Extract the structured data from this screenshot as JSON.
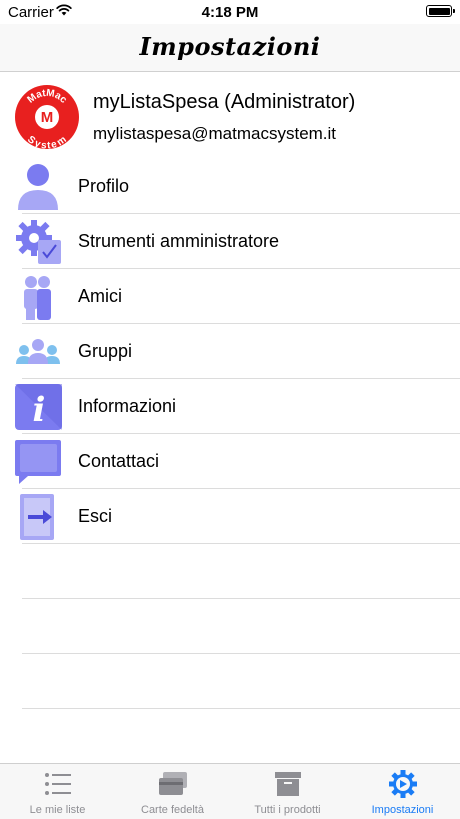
{
  "status": {
    "carrier": "Carrier",
    "time": "4:18 PM"
  },
  "header": {
    "title": "Impostazioni"
  },
  "user": {
    "name": "myListaSpesa (Administrator)",
    "email": "mylistaspesa@matmacsystem.it",
    "logo_text_top": "MatMac",
    "logo_letter": "M",
    "logo_text_bottom": "System"
  },
  "menu": {
    "items": [
      {
        "label": "Profilo",
        "icon": "person-icon"
      },
      {
        "label": "Strumenti amministratore",
        "icon": "admin-tools-icon"
      },
      {
        "label": "Amici",
        "icon": "friends-icon"
      },
      {
        "label": "Gruppi",
        "icon": "groups-icon"
      },
      {
        "label": "Informazioni",
        "icon": "info-icon"
      },
      {
        "label": "Contattaci",
        "icon": "chat-bubble-icon"
      },
      {
        "label": "Esci",
        "icon": "logout-icon"
      }
    ]
  },
  "tabs": [
    {
      "label": "Le mie liste",
      "icon": "list-icon"
    },
    {
      "label": "Carte fedeltà",
      "icon": "cards-icon"
    },
    {
      "label": "Tutti i prodotti",
      "icon": "box-icon"
    },
    {
      "label": "Impostazioni",
      "icon": "gear-icon",
      "active": true
    }
  ],
  "colors": {
    "icon_main": "#7b7bf0",
    "icon_light": "#a7a7f5",
    "logo_red": "#e8201f",
    "tab_active": "#1a7cf5",
    "tab_inactive": "#8e8e93"
  }
}
